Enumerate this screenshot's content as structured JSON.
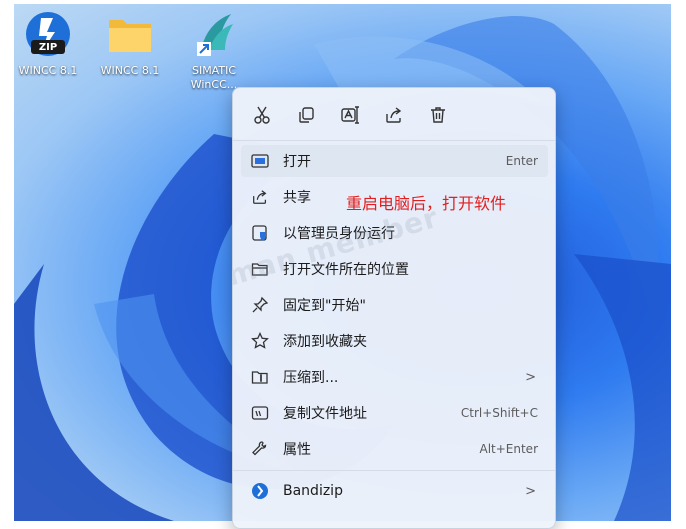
{
  "desktop": {
    "icons": [
      {
        "label": "WINCC 8.1",
        "badge": "ZIP"
      },
      {
        "label": "WINCC 8.1"
      },
      {
        "label_line1": "SIMATIC",
        "label_line2": "WinCC..."
      }
    ]
  },
  "menu": {
    "quick_actions": [
      "cut-icon",
      "copy-icon",
      "rename-icon",
      "share-icon",
      "delete-icon"
    ],
    "items": [
      {
        "label": "打开",
        "shortcut": "Enter"
      },
      {
        "label": "共享"
      },
      {
        "label": "以管理员身份运行"
      },
      {
        "label": "打开文件所在的位置"
      },
      {
        "label": "固定到\"开始\""
      },
      {
        "label": "添加到收藏夹"
      },
      {
        "label": "压缩到...",
        "arrow": ">"
      },
      {
        "label": "复制文件地址",
        "shortcut": "Ctrl+Shift+C"
      },
      {
        "label": "属性",
        "shortcut": "Alt+Enter"
      },
      {
        "label": "Bandizip",
        "arrow": ">"
      }
    ]
  },
  "annotation": "重启电脑后，打开软件",
  "watermark": "liman member",
  "colors": {
    "annotation": "#e02020",
    "accent": "#2a6fdb"
  }
}
